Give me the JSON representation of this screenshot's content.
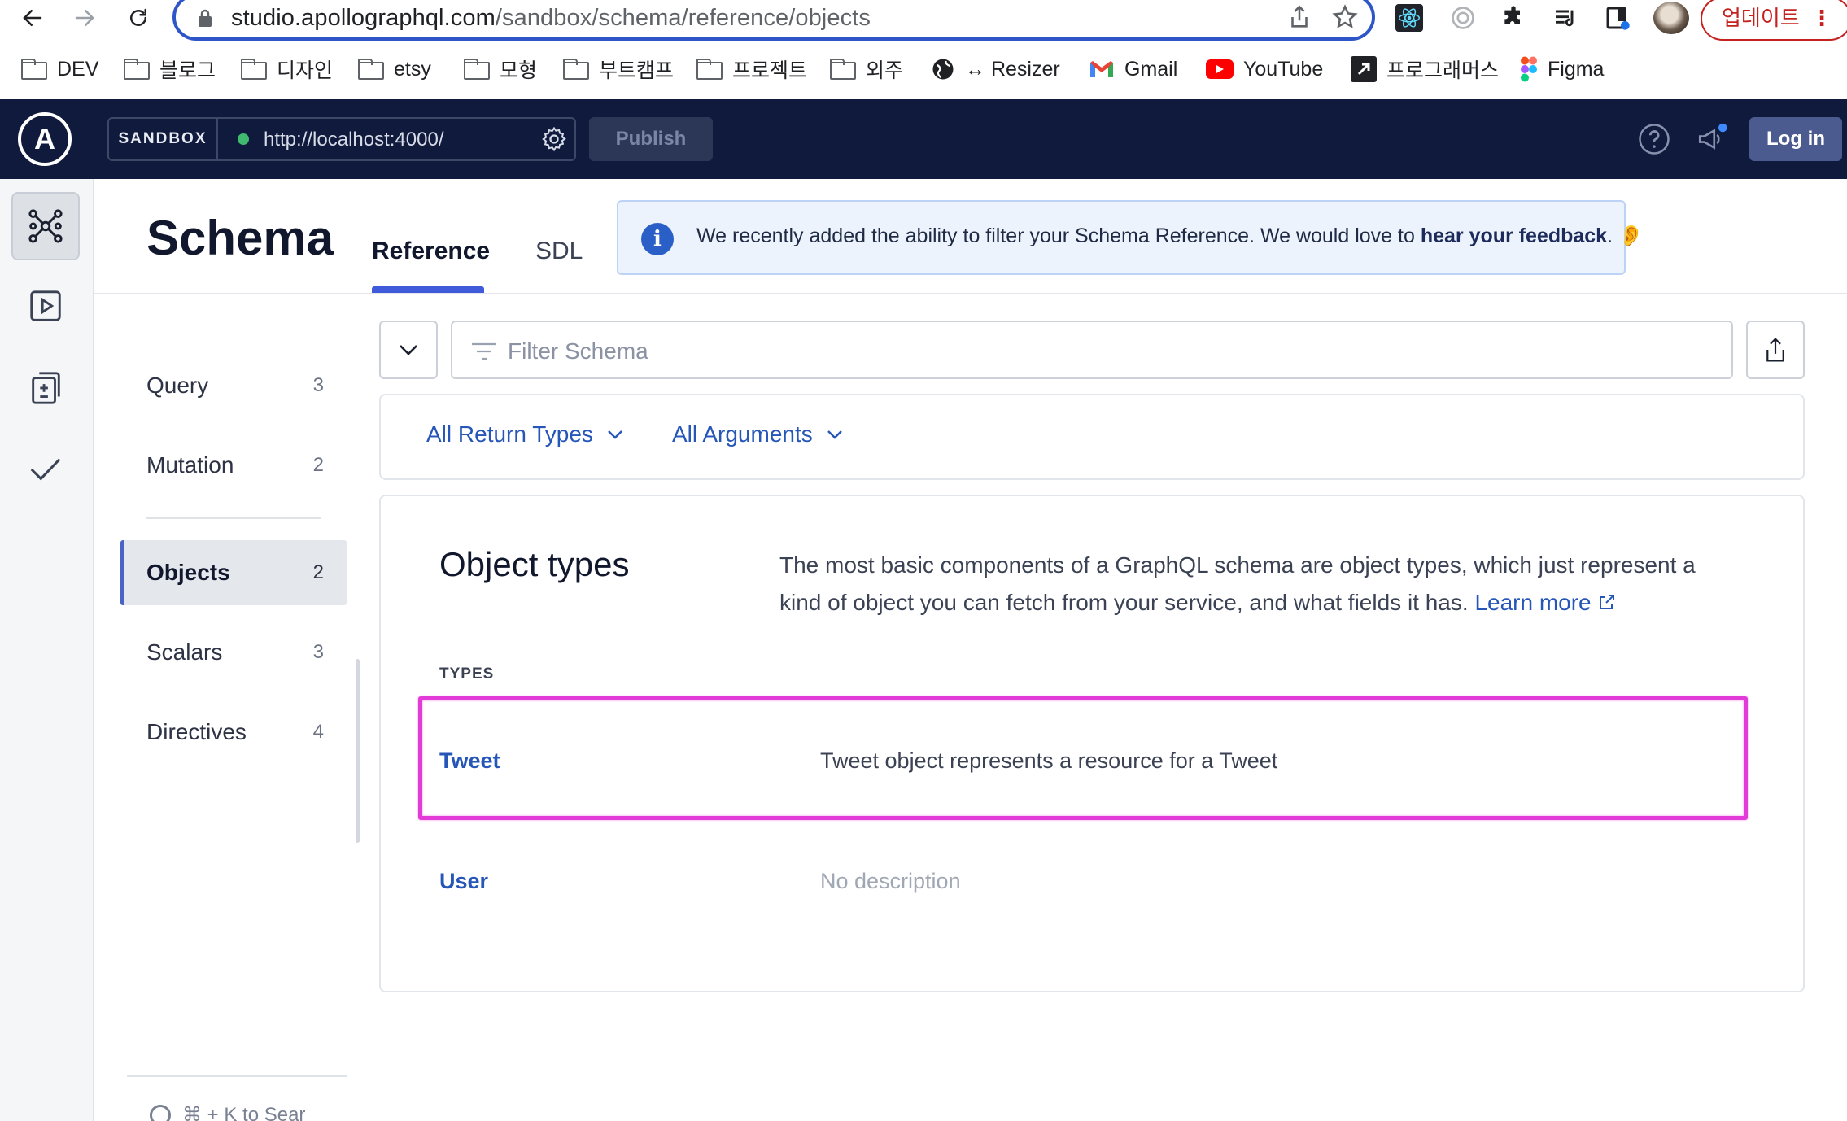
{
  "browser": {
    "url_host": "studio.apollographql.com",
    "url_path": "/sandbox/schema/reference/objects",
    "update_label": "업데이트",
    "bookmarks": [
      {
        "label": "DEV",
        "type": "folder"
      },
      {
        "label": "블로그",
        "type": "folder"
      },
      {
        "label": "디자인",
        "type": "folder"
      },
      {
        "label": "etsy",
        "type": "folder"
      },
      {
        "label": "모형",
        "type": "folder"
      },
      {
        "label": "부트캠프",
        "type": "folder"
      },
      {
        "label": "프로젝트",
        "type": "folder"
      },
      {
        "label": "외주",
        "type": "folder"
      },
      {
        "label": "↔ Resizer",
        "type": "globe-icon"
      },
      {
        "label": "Gmail",
        "type": "gmail-icon"
      },
      {
        "label": "YouTube",
        "type": "youtube-icon"
      },
      {
        "label": "프로그래머스",
        "type": "programmers-icon"
      },
      {
        "label": "Figma",
        "type": "figma-icon"
      }
    ]
  },
  "header": {
    "sandbox_tag": "SANDBOX",
    "endpoint_url": "http://localhost:4000/",
    "publish_label": "Publish",
    "login_label": "Log in"
  },
  "page": {
    "title": "Schema",
    "tabs": [
      {
        "label": "Reference",
        "active": true
      },
      {
        "label": "SDL",
        "active": false
      }
    ],
    "banner": {
      "text": "We recently added the ability to filter your Schema Reference. We would love to ",
      "link": "hear your feedback",
      "suffix": ". 👂"
    }
  },
  "sidebar": {
    "items": [
      {
        "label": "Query",
        "count": "3"
      },
      {
        "label": "Mutation",
        "count": "2"
      },
      {
        "label": "Objects",
        "count": "2",
        "active": true
      },
      {
        "label": "Scalars",
        "count": "3"
      },
      {
        "label": "Directives",
        "count": "4"
      }
    ],
    "search_hint": "⌘ + K to Sear"
  },
  "filter": {
    "placeholder": "Filter Schema",
    "return_types": "All Return Types",
    "arguments": "All Arguments"
  },
  "types_panel": {
    "title": "Object types",
    "description": "The most basic components of a GraphQL schema are object types, which just represent a kind of object you can fetch from your service, and what fields it has.",
    "learn_more": "Learn more",
    "section_label": "TYPES",
    "rows": [
      {
        "name": "Tweet",
        "description": "Tweet object represents a resource for a Tweet",
        "highlighted": true
      },
      {
        "name": "User",
        "description": "No description",
        "muted": true
      }
    ]
  },
  "colors": {
    "header_bg": "#0f1a3c",
    "accent": "#3f5bd9",
    "link": "#2656b8",
    "highlight_border": "#e33bd8",
    "status_dot": "#3fba6f"
  }
}
